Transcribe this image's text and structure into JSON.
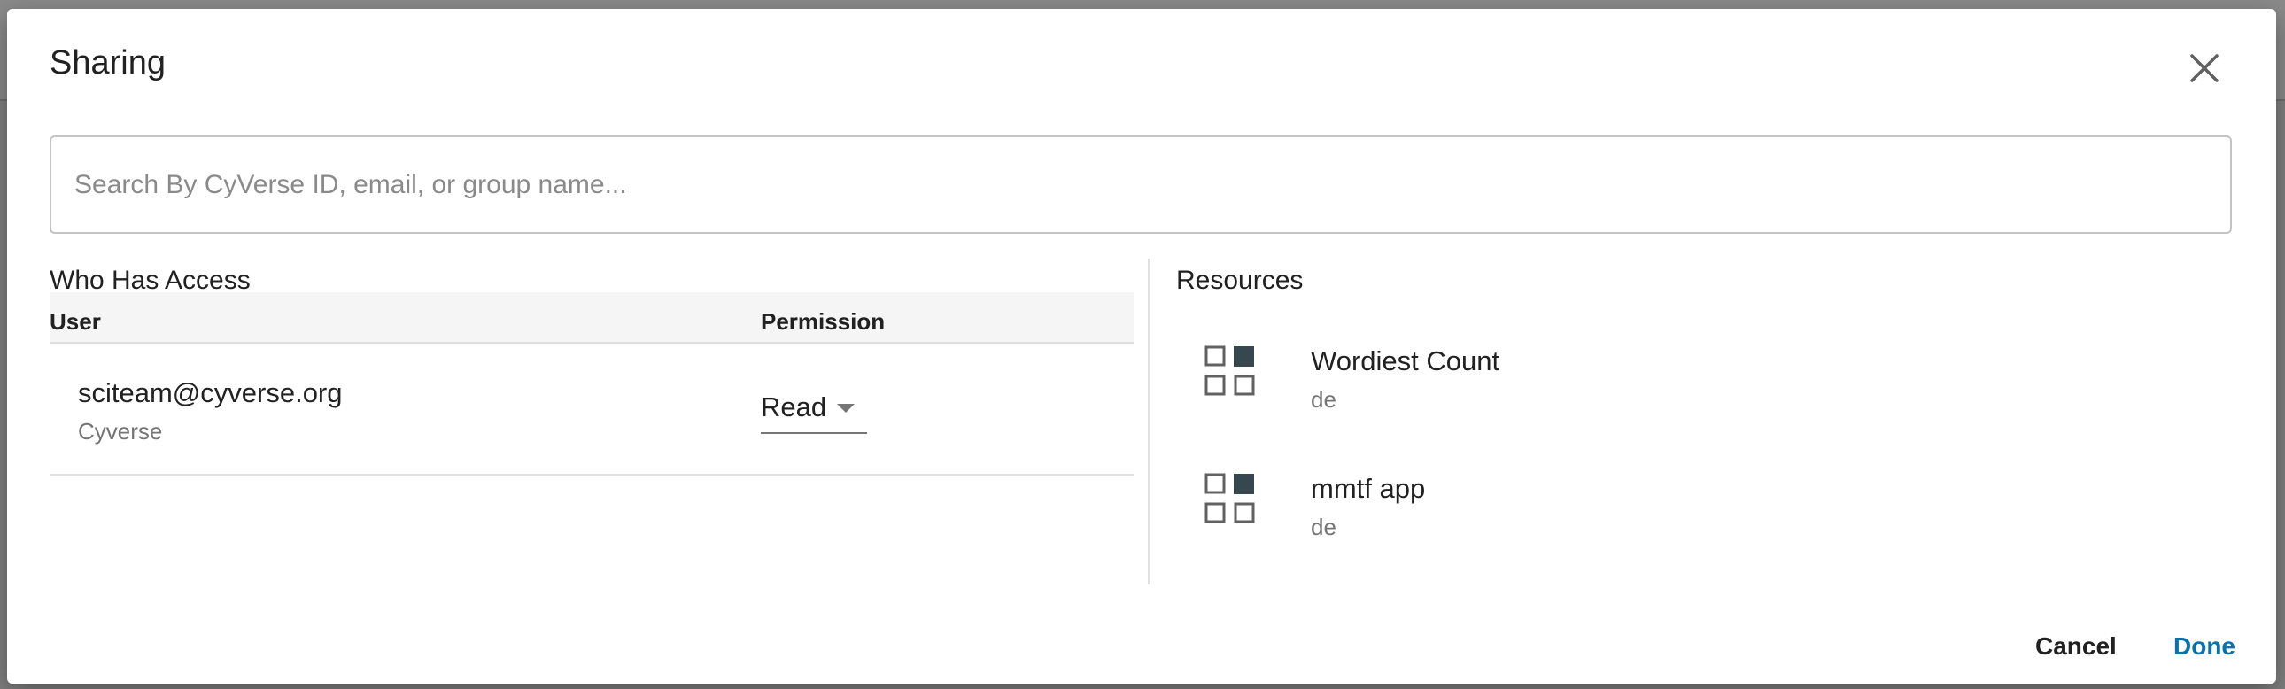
{
  "dialog": {
    "title": "Sharing"
  },
  "search": {
    "placeholder": "Search By CyVerse ID, email, or group name...",
    "value": ""
  },
  "who_has_access": {
    "title": "Who Has Access",
    "columns": [
      "User",
      "Permission"
    ],
    "rows": [
      {
        "user": "sciteam@cyverse.org",
        "org": "Cyverse",
        "permission": "Read"
      }
    ]
  },
  "resources": {
    "title": "Resources",
    "items": [
      {
        "name": "Wordiest Count",
        "owner": "de",
        "icon": "app-grid-icon"
      },
      {
        "name": "mmtf app",
        "owner": "de",
        "icon": "app-grid-icon"
      }
    ]
  },
  "actions": {
    "cancel_label": "Cancel",
    "done_label": "Done"
  },
  "colors": {
    "accent": "#0971ab",
    "icon_dark": "#37474f",
    "divider": "#e0e0e0"
  }
}
